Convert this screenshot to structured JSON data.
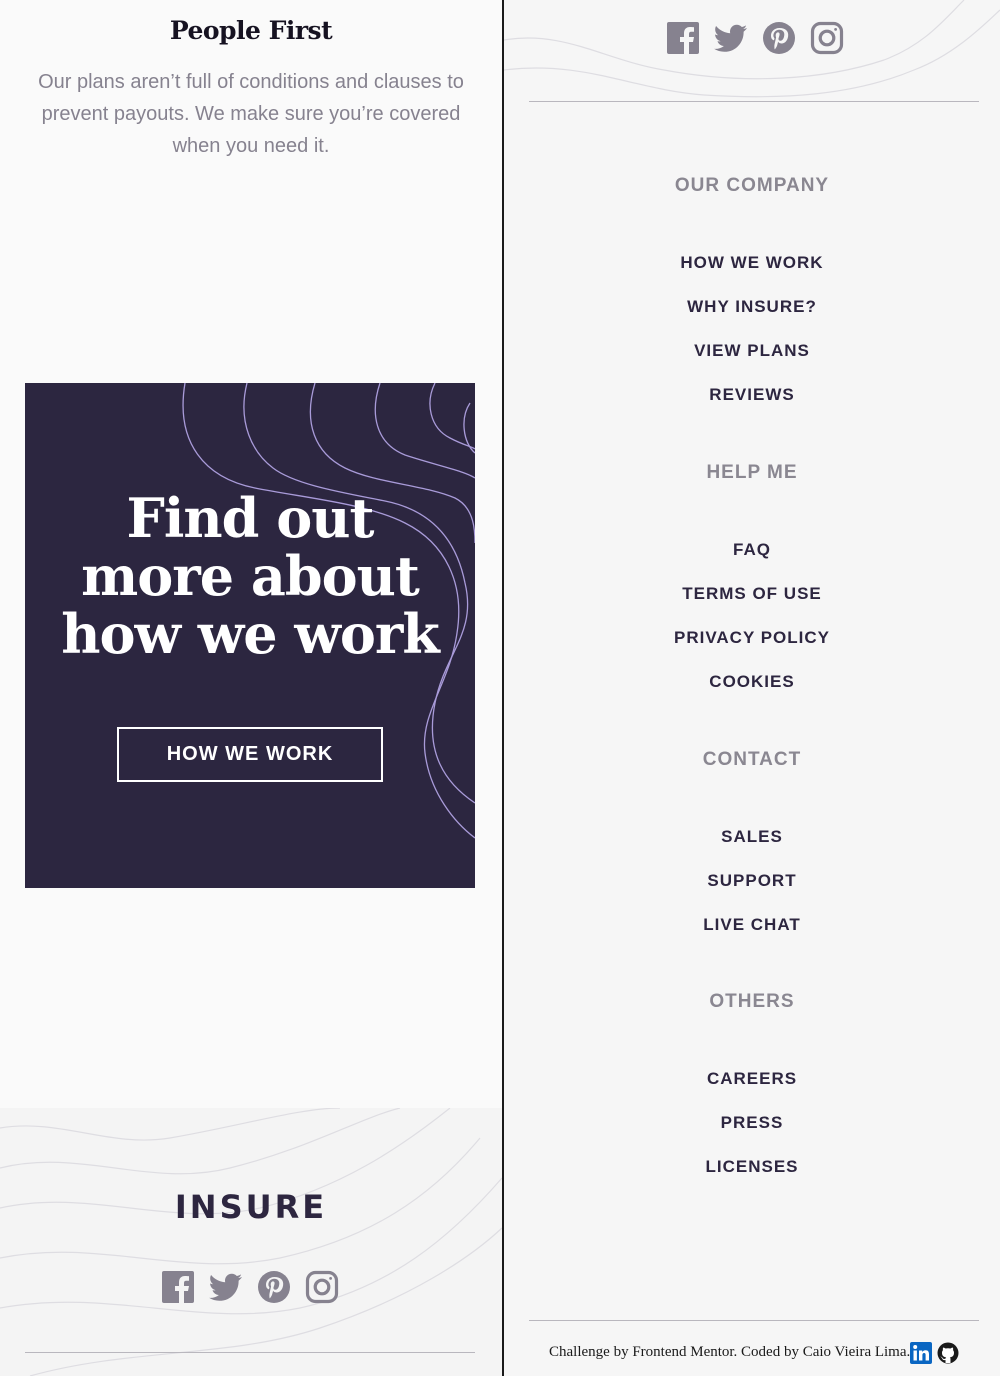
{
  "feature": {
    "title": "People First",
    "text": "Our plans aren’t full of conditions and clauses to prevent payouts. We make sure you’re covered when you need it."
  },
  "cta": {
    "heading_line1": "Find out",
    "heading_line2": "more about",
    "heading_line3": "how we work",
    "button": "HOW WE WORK"
  },
  "footer": {
    "logo": "INSURE",
    "social_icons": [
      "facebook-icon",
      "twitter-icon",
      "pinterest-icon",
      "instagram-icon"
    ]
  },
  "nav": {
    "sections": [
      {
        "heading": "OUR COMPANY",
        "links": [
          "HOW WE WORK",
          "WHY INSURE?",
          "VIEW PLANS",
          "REVIEWS"
        ]
      },
      {
        "heading": "HELP ME",
        "links": [
          "FAQ",
          "TERMS OF USE",
          "PRIVACY POLICY",
          "COOKIES"
        ]
      },
      {
        "heading": "CONTACT",
        "links": [
          "SALES",
          "SUPPORT",
          "LIVE CHAT"
        ]
      },
      {
        "heading": "OTHERS",
        "links": [
          "CAREERS",
          "PRESS",
          "LICENSES"
        ]
      }
    ]
  },
  "attribution": {
    "text": "Challenge by Frontend Mentor. Coded by Caio Vieira Lima.",
    "icons": [
      "linkedin-icon",
      "github-icon"
    ]
  },
  "colors": {
    "dark_violet": "#2c2640",
    "grayish_violet": "#86828f",
    "line_violet": "#a99bd9",
    "linkedin_blue": "#0a66c2"
  }
}
